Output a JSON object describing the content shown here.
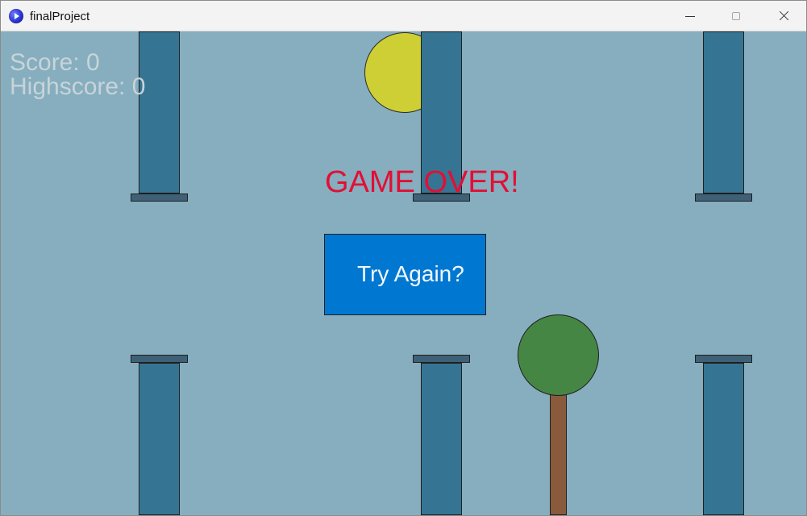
{
  "window": {
    "title": "finalProject",
    "controls": {
      "minimize_icon": "minimize-icon",
      "maximize_icon": "maximize-icon",
      "close_icon": "close-icon"
    }
  },
  "game": {
    "score_label": "Score: 0",
    "highscore_label": "Highscore: 0",
    "status": "GAME OVER!",
    "action_button": "Try Again?",
    "colors": {
      "sky": "#86aebf",
      "pipe": "#357593",
      "pipe_cap": "#3f6177",
      "sun": "#cdcf35",
      "tree_canopy": "#468644",
      "tree_trunk": "#8a5a3c",
      "game_over_text": "#e30e35",
      "button": "#0078d2",
      "score_text": "#c7d4da"
    }
  }
}
